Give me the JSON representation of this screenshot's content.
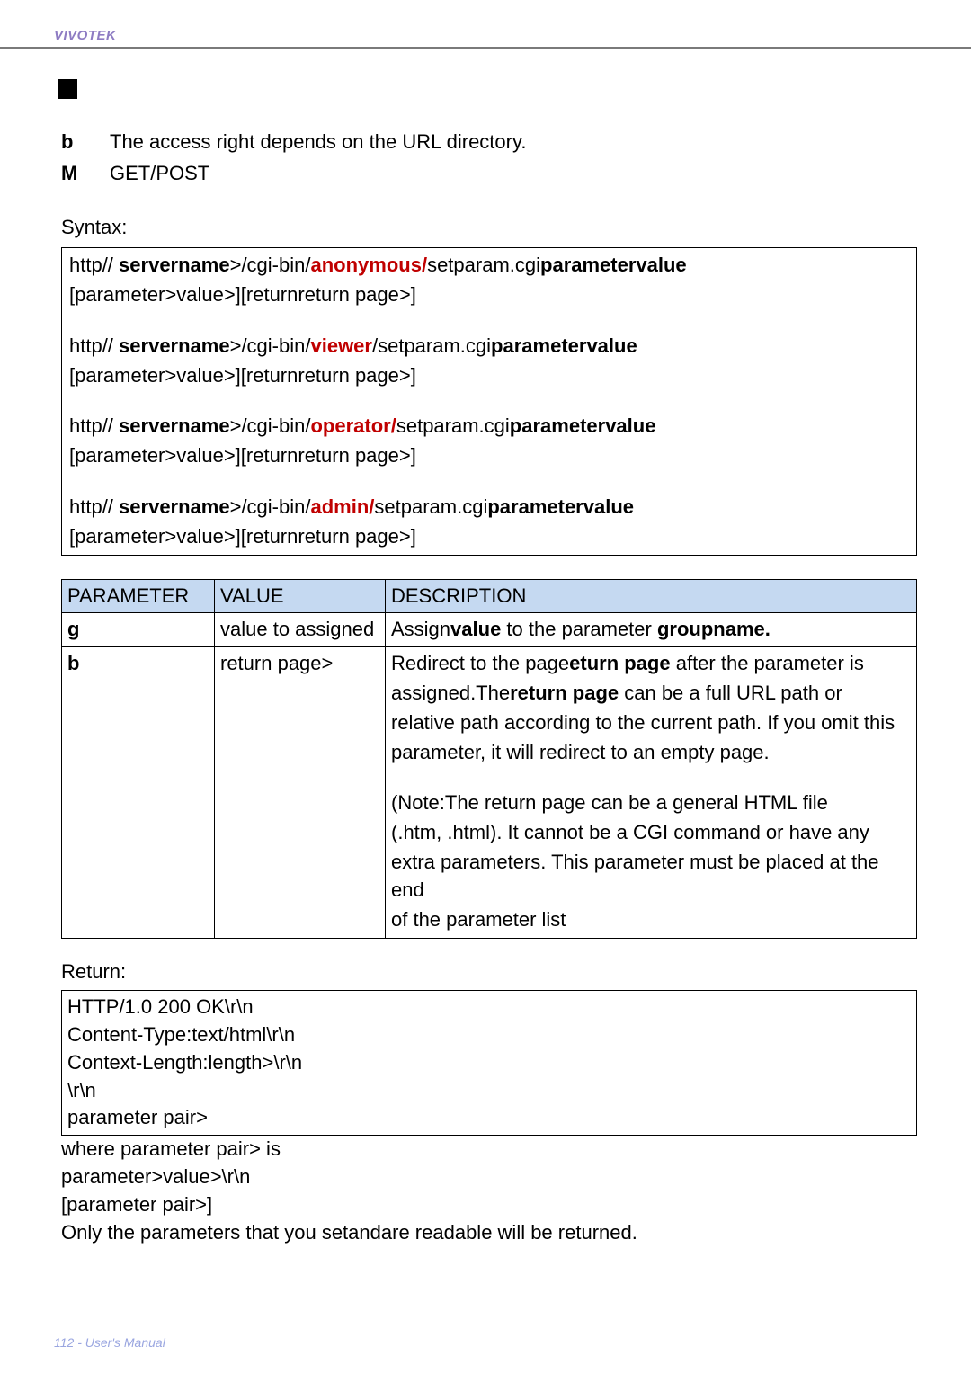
{
  "brand": "VIVOTEK",
  "bullets": {
    "b1_label": "b",
    "b1_text": "The access right depends on the URL directory.",
    "b2_label": "M",
    "b2_text": "GET/POST"
  },
  "syntax_label": "Syntax:",
  "syntax": {
    "l1_a": "http//   ",
    "l1_b": "servername",
    "l1_c": ">/cgi-bin/",
    "l1_d": "anonymous/",
    "l1_e": "setparam.cgi",
    "l1_f": "parameter",
    "l1_g": "value",
    "line_sub": "[parameter>value>][returnreturn page>]",
    "l3_a": "http//   ",
    "l3_b": "servername",
    "l3_c": ">/cgi-bin/",
    "l3_d": "viewer",
    "l3_e": "/setparam.cgi",
    "l3_f": "parameter",
    "l3_g": "value",
    "l5_a": "http//   ",
    "l5_b": "servername",
    "l5_c": ">/cgi-bin/",
    "l5_d": "operator/",
    "l5_e": "setparam.cgi",
    "l5_f": "parameter",
    "l5_g": "value",
    "l7_a": "http//   ",
    "l7_b": "servername",
    "l7_c": ">/cgi-bin/",
    "l7_d": "admin/",
    "l7_e": "setparam.cgi",
    "l7_f": "parameter",
    "l7_g": "value"
  },
  "table": {
    "h1": "PARAMETER",
    "h2": "VALUE",
    "h3": "DESCRIPTION",
    "r1c1": "g",
    "r1c2": "value to assigned",
    "r1c3_a": "    Assign",
    "r1c3_b": "value",
    "r1c3_c": " to the parameter ",
    "r1c3_d": "groupname.",
    "r2c1": "b",
    "r2c2": "return page>",
    "d1_a": "Redirect to the page",
    "d1_b": "eturn page",
    "d1_c": " after the parameter is",
    "d2_a": "assigned.The",
    "d2_b": "return page",
    "d2_c": " can be a full URL path or",
    "d3": "relative path according to the current path. If you omit this",
    "d4": "parameter, it will redirect to an empty page.",
    "d5": "(Note:The return page can be a general HTML file",
    "d6": "(.htm, .html). It cannot be a CGI command or have any",
    "d7": "extra parameters. This parameter must be placed at the end",
    "d8": "of the parameter list"
  },
  "return_label": "Return:",
  "return_box": {
    "l1": "HTTP/1.0 200 OK\\r\\n",
    "l2": "Content-Type:text/html\\r\\n",
    "l3": "Context-Length:length>\\r\\n",
    "l4": "\\r\\n",
    "l5": "parameter pair>"
  },
  "after": {
    "l1": "where parameter pair> is",
    "l2": "parameter>value>\\r\\n",
    "l3": "[parameter pair>]",
    "l4_a": "Only the parameters that you set",
    "l4_b": "and",
    "l4_c": "are readable will be returned."
  },
  "footer": "112 - User's Manual"
}
